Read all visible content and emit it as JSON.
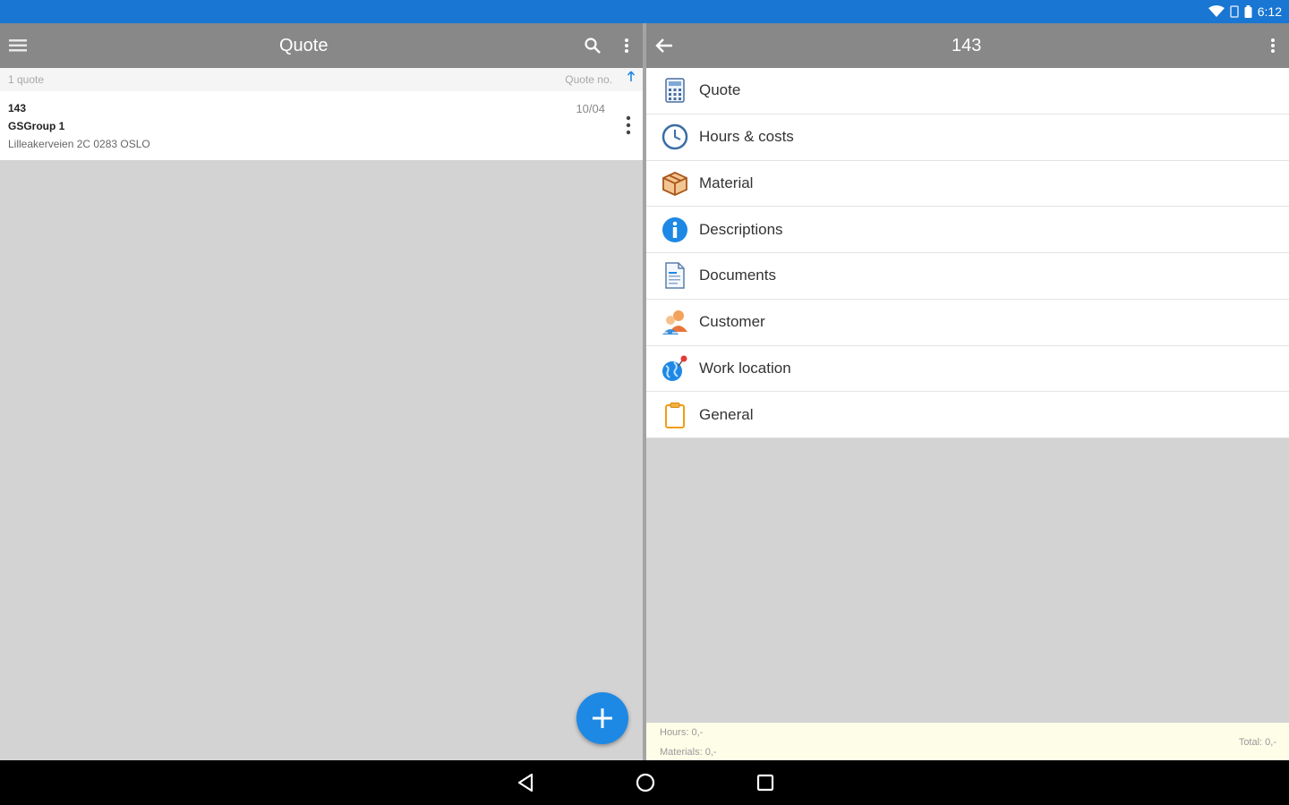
{
  "status_bar": {
    "time": "6:12"
  },
  "left_pane": {
    "title": "Quote",
    "list_count": "1 quote",
    "sort_label": "Quote no.",
    "items": [
      {
        "number": "143",
        "customer": "GSGroup 1",
        "address": "Lilleakerveien 2C 0283 OSLO",
        "date": "10/04"
      }
    ]
  },
  "right_pane": {
    "title": "143",
    "menu": [
      {
        "label": "Quote",
        "icon": "calculator-icon"
      },
      {
        "label": "Hours & costs",
        "icon": "clock-icon"
      },
      {
        "label": "Material",
        "icon": "box-icon"
      },
      {
        "label": "Descriptions",
        "icon": "info-icon"
      },
      {
        "label": "Documents",
        "icon": "document-icon"
      },
      {
        "label": "Customer",
        "icon": "customer-icon"
      },
      {
        "label": "Work location",
        "icon": "globe-pin-icon"
      },
      {
        "label": "General",
        "icon": "clipboard-icon"
      }
    ],
    "footer": {
      "hours": "Hours: 0,-",
      "materials": "Materials: 0,-",
      "total": "Total: 0,-"
    }
  },
  "colors": {
    "status_bar": "#1976d2",
    "toolbar": "#888888",
    "fab": "#1e88e5",
    "footer_bg": "#fdfde8"
  }
}
